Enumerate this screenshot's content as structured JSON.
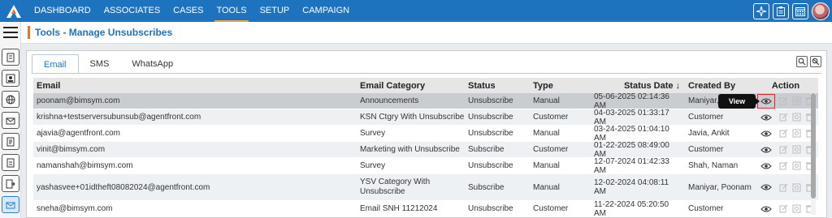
{
  "nav": {
    "items": [
      {
        "label": "DASHBOARD",
        "active": false
      },
      {
        "label": "ASSOCIATES",
        "active": false
      },
      {
        "label": "CASES",
        "active": false
      },
      {
        "label": "TOOLS",
        "active": true
      },
      {
        "label": "SETUP",
        "active": false
      },
      {
        "label": "CAMPAIGN",
        "active": false
      }
    ],
    "right_icons": [
      "sparkle-icon",
      "clipboard-icon",
      "calendar-grid-icon"
    ]
  },
  "left_rail": {
    "icons": [
      "document-icon",
      "contact-card-icon",
      "globe-icon",
      "mail-icon",
      "report-icon",
      "notes-icon",
      "file-export-icon",
      "envelope-active-icon"
    ]
  },
  "page": {
    "title": "Tools - Manage Unsubscribes"
  },
  "tabs": [
    {
      "label": "Email",
      "active": true
    },
    {
      "label": "SMS",
      "active": false
    },
    {
      "label": "WhatsApp",
      "active": false
    }
  ],
  "table": {
    "columns": {
      "email": "Email",
      "category": "Email Category",
      "status": "Status",
      "type": "Type",
      "status_date": "Status Date",
      "created_by": "Created By",
      "action": "Action"
    },
    "sort_indicator": "↓",
    "rows": [
      {
        "email": "poonam@bimsym.com",
        "category": "Announcements",
        "status": "Unsubscribe",
        "type": "Manual",
        "status_date": "05-06-2025 02:14:36 AM",
        "created_by": "Maniyar,"
      },
      {
        "email": "krishna+testserversubunsub@agentfront.com",
        "category": "KSN Ctgry With Unsubscribe",
        "status": "Unsubscribe",
        "type": "Customer",
        "status_date": "04-03-2025 01:33:17 AM",
        "created_by": "Customer"
      },
      {
        "email": "ajavia@agentfront.com",
        "category": "Survey",
        "status": "Unsubscribe",
        "type": "Manual",
        "status_date": "03-24-2025 01:04:10 AM",
        "created_by": "Javia, Ankit"
      },
      {
        "email": "vinit@bimsym.com",
        "category": "Marketing with Unsubscribe",
        "status": "Subscribe",
        "type": "Customer",
        "status_date": "01-22-2025 08:49:00 AM",
        "created_by": "Customer"
      },
      {
        "email": "namanshah@bimsym.com",
        "category": "Survey",
        "status": "Unsubscribe",
        "type": "Manual",
        "status_date": "12-07-2024 01:42:33 AM",
        "created_by": "Shah, Naman"
      },
      {
        "email": "yashasvee+01idtheft08082024@agentfront.com",
        "category": "YSV Category With Unsubscribe",
        "status": "Subscribe",
        "type": "Manual",
        "status_date": "12-02-2024 04:08:11 AM",
        "created_by": "Maniyar, Poonam"
      },
      {
        "email": "sneha@bimsym.com",
        "category": "Email SNH 11212024",
        "status": "Unsubscribe",
        "type": "Customer",
        "status_date": "11-22-2024 05:20:50 AM",
        "created_by": "Customer"
      }
    ]
  },
  "tooltip": {
    "text": "View"
  },
  "colors": {
    "nav_bg": "#1e73be",
    "accent_orange": "#e8732c",
    "title_blue": "#1e73be",
    "highlight_red": "#e02020"
  }
}
